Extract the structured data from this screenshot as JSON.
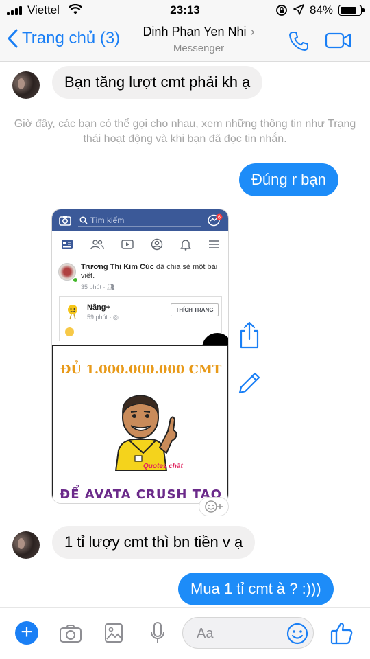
{
  "status_bar": {
    "carrier": "Viettel",
    "time": "23:13",
    "battery": "84%",
    "battery_level": 0.84
  },
  "header": {
    "back_label": "Trang chủ (3)",
    "contact_name": "Dinh Phan Yen Nhi",
    "subtitle": "Messenger"
  },
  "messages": {
    "m1": "Bạn tăng lượt cmt phải kh ạ",
    "system_note": "Giờ đây, các bạn có thể gọi cho nhau, xem những thông tin như Trạng thái hoạt động và khi bạn đã đọc tin nhắn.",
    "m2": "Đúng r bạn",
    "m3": "1 tỉ lượy cmt thì bn tiền v ạ",
    "m4": "Mua 1 tỉ cmt à ? :)))"
  },
  "shared_image": {
    "search_placeholder": "Tìm kiếm",
    "post_author": "Trương Thị Kim Cúc",
    "post_action": "đã chia sẻ một bài viết.",
    "post_time": "35 phút ·",
    "page_name": "Nắng+",
    "page_time": "59 phút ·",
    "like_page_button": "THÍCH TRANG",
    "meme_top": "ĐỦ 1.000.000.000 CMT",
    "meme_bottom": "ĐỂ AVATA CRUSH TAO",
    "watermark": "Quotes chất",
    "notification_count": "6"
  },
  "composer": {
    "placeholder": "Aa"
  },
  "colors": {
    "accent": "#1a7ff5",
    "outgoing_bubble": "#1d8cf8",
    "incoming_bubble": "#f1f0f0",
    "facebook_blue": "#3b5998"
  }
}
